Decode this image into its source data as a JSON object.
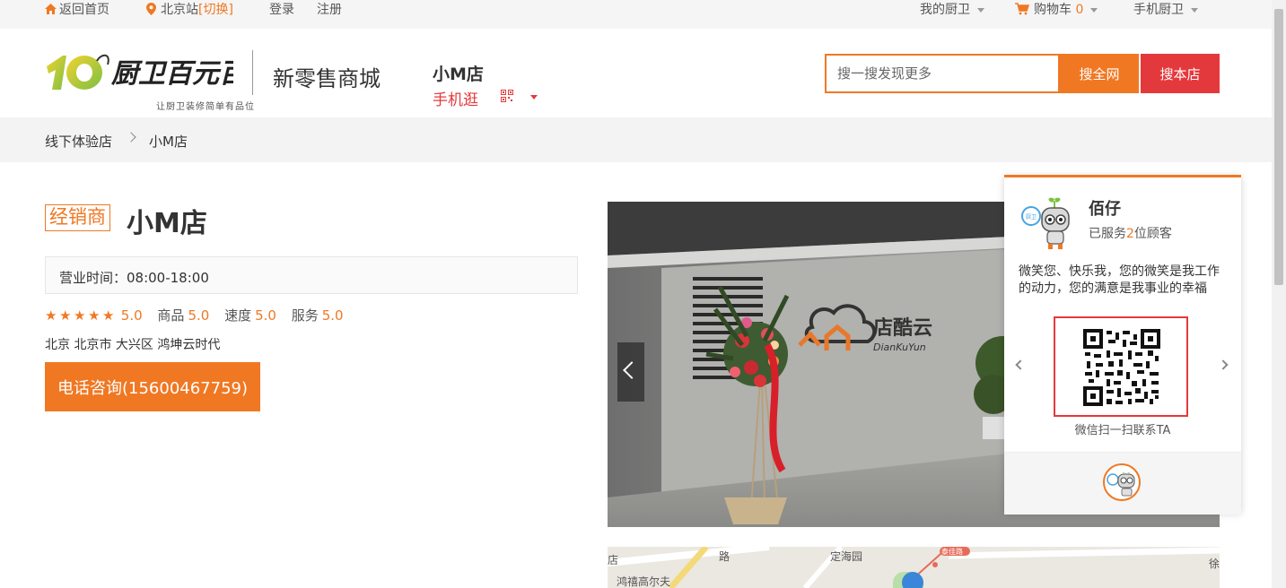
{
  "topbar": {
    "home": "返回首页",
    "city": "北京站",
    "switch": "[切换]",
    "login": "登录",
    "register": "注册",
    "my_account": "我的厨卫",
    "cart_label": "购物车",
    "cart_count": "0",
    "mobile": "手机厨卫"
  },
  "header": {
    "logo_tagline": "让厨卫装修简单有品位",
    "slogan": "新零售商城",
    "store_name": "小M店",
    "mobile_link": "手机逛"
  },
  "search": {
    "placeholder": "搜一搜发现更多",
    "btn_all": "搜全网",
    "btn_store": "搜本店"
  },
  "breadcrumb": {
    "parent": "线下体验店",
    "current": "小M店"
  },
  "store": {
    "badge": "经销商",
    "name": "小M店",
    "hours": "营业时间：08:00-18:00",
    "rating_overall": "5.0",
    "rating_goods_label": "商品",
    "rating_goods": "5.0",
    "rating_speed_label": "速度",
    "rating_speed": "5.0",
    "rating_service_label": "服务",
    "rating_service": "5.0",
    "address": "北京 北京市 大兴区 鸿坤云时代",
    "phone_button": "电话咨询(15600467759)"
  },
  "photo": {
    "sign_cn": "店酷云",
    "sign_en": "DianKuYun"
  },
  "map": {
    "label_1": "店",
    "label_2": "路",
    "label_3": "定海园",
    "label_4": "鸿禧高尔夫",
    "label_5": "徐",
    "label_6": "泰佳路"
  },
  "agent": {
    "name": "佰仔",
    "served_prefix": "已服务",
    "served_count": "2",
    "served_suffix": "位顾客",
    "motto": "微笑您、快乐我，您的微笑是我工作的动力，您的满意是我事业的幸福",
    "qr_caption": "微信扫一扫联系TA"
  },
  "colors": {
    "accent": "#f07823",
    "red": "#e4393c"
  }
}
